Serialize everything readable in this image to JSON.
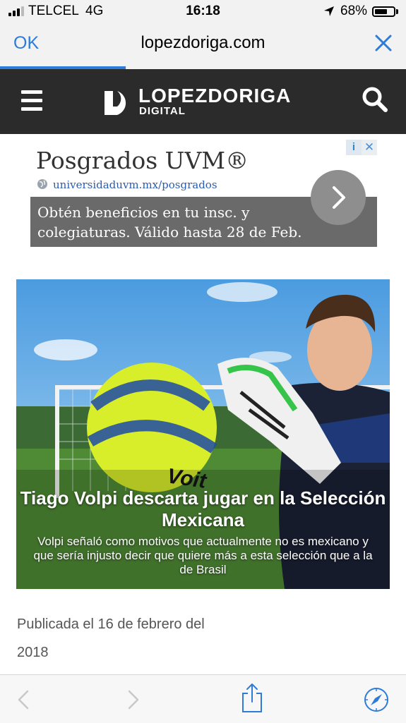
{
  "status_bar": {
    "carrier": "TELCEL",
    "network": "4G",
    "time": "16:18",
    "battery_percent": "68%",
    "battery_level": 0.68
  },
  "nav_bar": {
    "done_label": "OK",
    "url": "lopezdoriga.com",
    "load_progress": 0.31
  },
  "site_header": {
    "logo_title": "LOPEZDORIGA",
    "logo_subtitle": "DIGITAL"
  },
  "ad": {
    "title": "Posgrados UVM®",
    "url": "universidaduvm.mx/posgrados",
    "description": "Obtén beneficios en tu insc. y colegiaturas. Válido hasta 28 de Feb.",
    "info_label": "i",
    "close_label": "✕"
  },
  "article": {
    "headline": "Tiago Volpi descarta jugar en la Selección Mexicana",
    "summary": "Volpi señaló como motivos que actualmente no es mexicano y que sería injusto decir que quiere más a esta selección que a la de Brasil",
    "ball_brand": "Voit"
  },
  "meta": {
    "published": "Publicada el 16 de febrero del 2018"
  },
  "colors": {
    "accent": "#2f7bd8",
    "header_bg": "#2b2b2b",
    "ad_bar": "#6a6a6a"
  }
}
